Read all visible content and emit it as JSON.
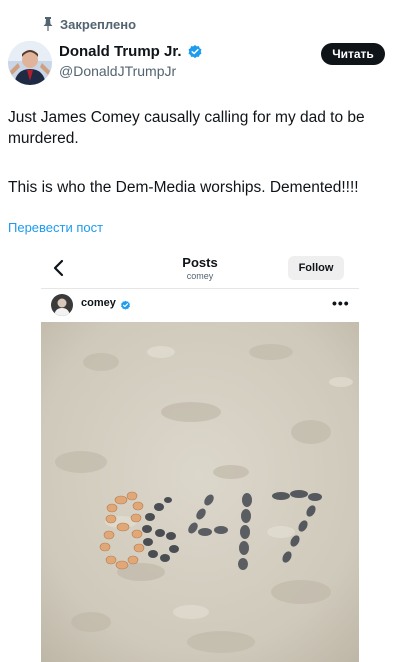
{
  "pinned": {
    "label": "Закреплено",
    "icon": "pin-icon"
  },
  "author": {
    "name": "Donald Trump Jr.",
    "handle": "@DonaldJTrumpJr",
    "verified_icon": "verified-badge-icon"
  },
  "actions": {
    "read_label": "Читать"
  },
  "tweet": {
    "line1": "Just James Comey causally calling for my dad to be murdered.",
    "line2": "This is who the Dem-Media worships. Demented!!!!"
  },
  "translate": {
    "label": "Перевести пост"
  },
  "embedded_post": {
    "title": "Posts",
    "subtitle": "comey",
    "follow_label": "Follow",
    "username": "comey",
    "more_icon": "more-options-icon",
    "back_icon": "back-arrow-icon",
    "photo_text": "8647"
  },
  "colors": {
    "link": "#1d9bf0",
    "verified": "#1d9bf0",
    "dark_button": "#0f1419",
    "sand": "#d3cdbf"
  }
}
